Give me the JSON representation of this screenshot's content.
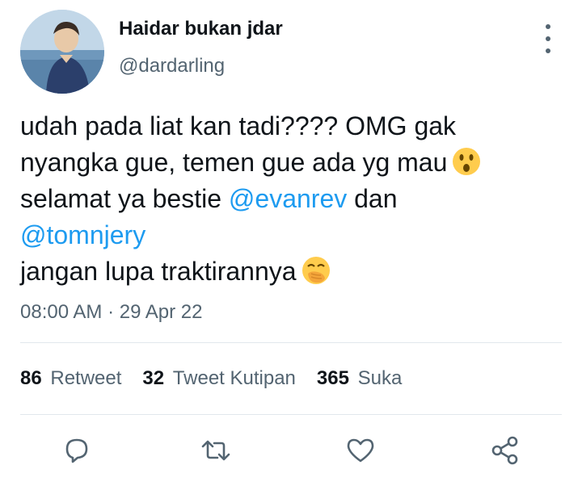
{
  "author": {
    "display_name": "Haidar bukan jdar",
    "handle": "@dardarling"
  },
  "tweet": {
    "line1": "udah pada liat kan tadi???? OMG gak",
    "line2": "nyangka gue, temen gue ada yg mau",
    "line2_emoji": "astonished-face",
    "line3_text": "selamat ya bestie ",
    "mention1": "@evanrev",
    "line3_after": " dan",
    "mention2": "@tomnjery",
    "line5": "jangan lupa traktirannya",
    "line5_emoji": "face-with-hand-over-mouth"
  },
  "timestamp": "08:00 AM · 29 Apr 22",
  "stats": {
    "retweets_count": "86",
    "retweets_label": "Retweet",
    "quotes_count": "32",
    "quotes_label": "Tweet Kutipan",
    "likes_count": "365",
    "likes_label": "Suka"
  },
  "actions": [
    "reply-icon",
    "retweet-icon",
    "like-icon",
    "share-icon"
  ],
  "colors": {
    "mention": "#1d9bf0",
    "secondary_text": "#536471",
    "primary_text": "#0f1419",
    "icon": "#536471"
  }
}
